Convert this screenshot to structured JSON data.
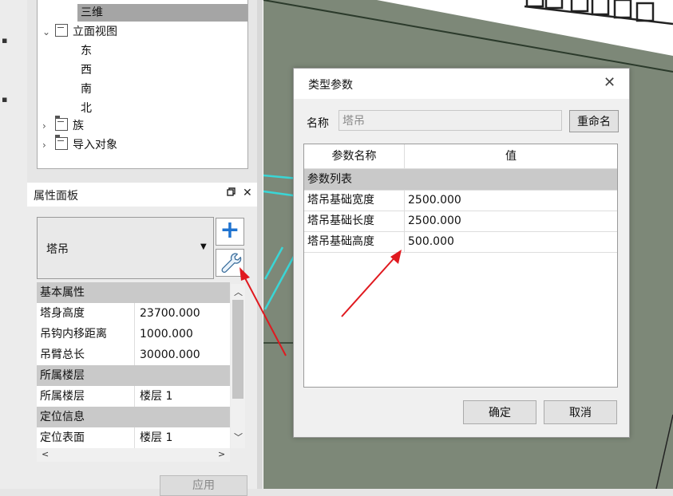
{
  "project_browser": {
    "selected_view": "三维",
    "elevation_group": "立面视图",
    "elevations": [
      "东",
      "西",
      "南",
      "北"
    ],
    "families": "族",
    "imports": "导入对象"
  },
  "properties_panel": {
    "title": "属性面板",
    "dock_icon": "restore-icon",
    "close_glyph": "✕",
    "type_name": "塔吊",
    "add_glyph": "+",
    "rows": [
      {
        "kind": "category",
        "label": "基本属性"
      },
      {
        "kind": "param",
        "label": "塔身高度",
        "value": "23700.000"
      },
      {
        "kind": "param",
        "label": "吊钩内移距离",
        "value": "1000.000"
      },
      {
        "kind": "param",
        "label": "吊臂总长",
        "value": "30000.000"
      },
      {
        "kind": "category",
        "label": "所属楼层"
      },
      {
        "kind": "param",
        "label": "所属楼层",
        "value": "楼层 1"
      },
      {
        "kind": "category",
        "label": "定位信息"
      },
      {
        "kind": "param",
        "label": "定位表面",
        "value": "楼层 1"
      }
    ],
    "apply_label": "应用"
  },
  "type_dialog": {
    "title": "类型参数",
    "close_glyph": "✕",
    "name_label": "名称",
    "name_value": "塔吊",
    "rename_label": "重命名",
    "columns": [
      "参数名称",
      "值"
    ],
    "category_label": "参数列表",
    "params": [
      {
        "label": "塔吊基础宽度",
        "value": "2500.000"
      },
      {
        "label": "塔吊基础长度",
        "value": "2500.000"
      },
      {
        "label": "塔吊基础高度",
        "value": "500.000"
      }
    ],
    "ok_label": "确定",
    "cancel_label": "取消"
  },
  "colors": {
    "accent": "#1f73d0",
    "annotation_arrow": "#e0191f",
    "viewport_ground": "#7d8878",
    "model_lines": "#3ad6d6"
  }
}
